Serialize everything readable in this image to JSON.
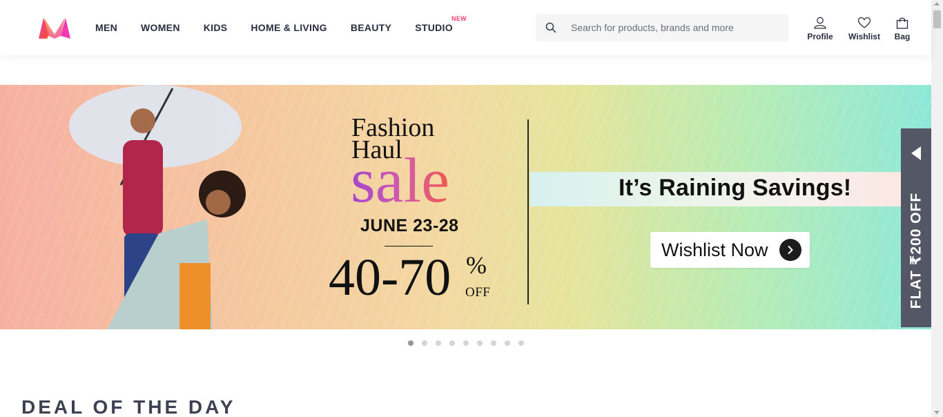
{
  "header": {
    "logo_icon": "myntra-logo",
    "nav": [
      {
        "label": "MEN"
      },
      {
        "label": "WOMEN"
      },
      {
        "label": "KIDS"
      },
      {
        "label": "HOME & LIVING"
      },
      {
        "label": "BEAUTY"
      },
      {
        "label": "STUDIO",
        "badge": "NEW"
      }
    ],
    "search": {
      "placeholder": "Search for products, brands and more",
      "value": ""
    },
    "actions": {
      "profile": "Profile",
      "wishlist": "Wishlist",
      "bag": "Bag"
    }
  },
  "banner": {
    "title_line1": "Fashion",
    "title_line2": "Haul",
    "sale_word": "sale",
    "dates": "JUNE 23-28",
    "discount": "40-70",
    "percent": "%",
    "off": "OFF",
    "tagline": "It’s Raining Savings!",
    "cta": "Wishlist Now"
  },
  "side_tab": {
    "label": "FLAT ₹200 OFF"
  },
  "carousel": {
    "total": 9,
    "active_index": 0
  },
  "sections": {
    "deal_title": "DEAL OF THE DAY"
  },
  "colors": {
    "accent": "#ff3f6c",
    "text": "#282c3f",
    "side_tab": "#535766"
  }
}
